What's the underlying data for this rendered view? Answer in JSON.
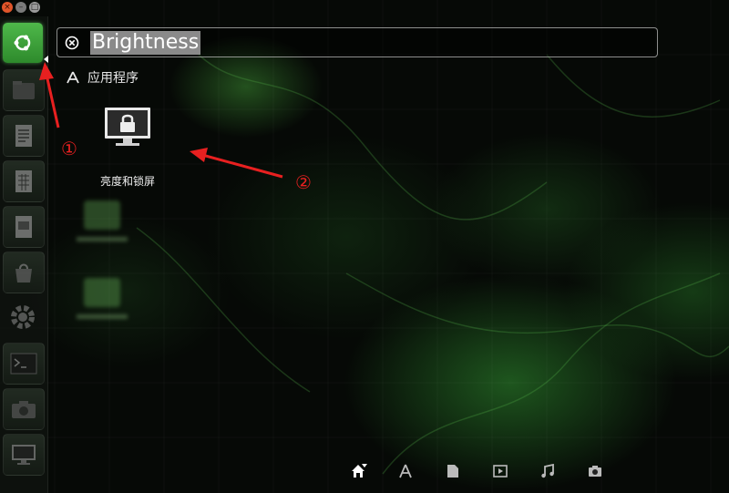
{
  "window_controls": {
    "close_glyph": "×",
    "min_glyph": "–",
    "max_glyph": "□"
  },
  "launcher": {
    "items": [
      {
        "name": "ubuntu-dash-icon"
      },
      {
        "name": "files-icon"
      },
      {
        "name": "writer-icon"
      },
      {
        "name": "calc-icon"
      },
      {
        "name": "impress-icon"
      },
      {
        "name": "software-center-icon"
      },
      {
        "name": "settings-gear-icon"
      },
      {
        "name": "terminal-icon"
      },
      {
        "name": "screenshot-icon"
      },
      {
        "name": "display-icon"
      }
    ]
  },
  "search": {
    "query": "Brightness"
  },
  "category": {
    "label": "应用程序"
  },
  "results": [
    {
      "label": "亮度和锁屏",
      "icon": "monitor-lock-icon"
    }
  ],
  "annotations": {
    "marker1": "①",
    "marker2": "②",
    "color": "#e82020"
  },
  "lenses": [
    {
      "name": "home-lens-icon",
      "active": true
    },
    {
      "name": "applications-lens-icon"
    },
    {
      "name": "files-lens-icon"
    },
    {
      "name": "video-lens-icon"
    },
    {
      "name": "music-lens-icon"
    },
    {
      "name": "photo-lens-icon"
    }
  ]
}
